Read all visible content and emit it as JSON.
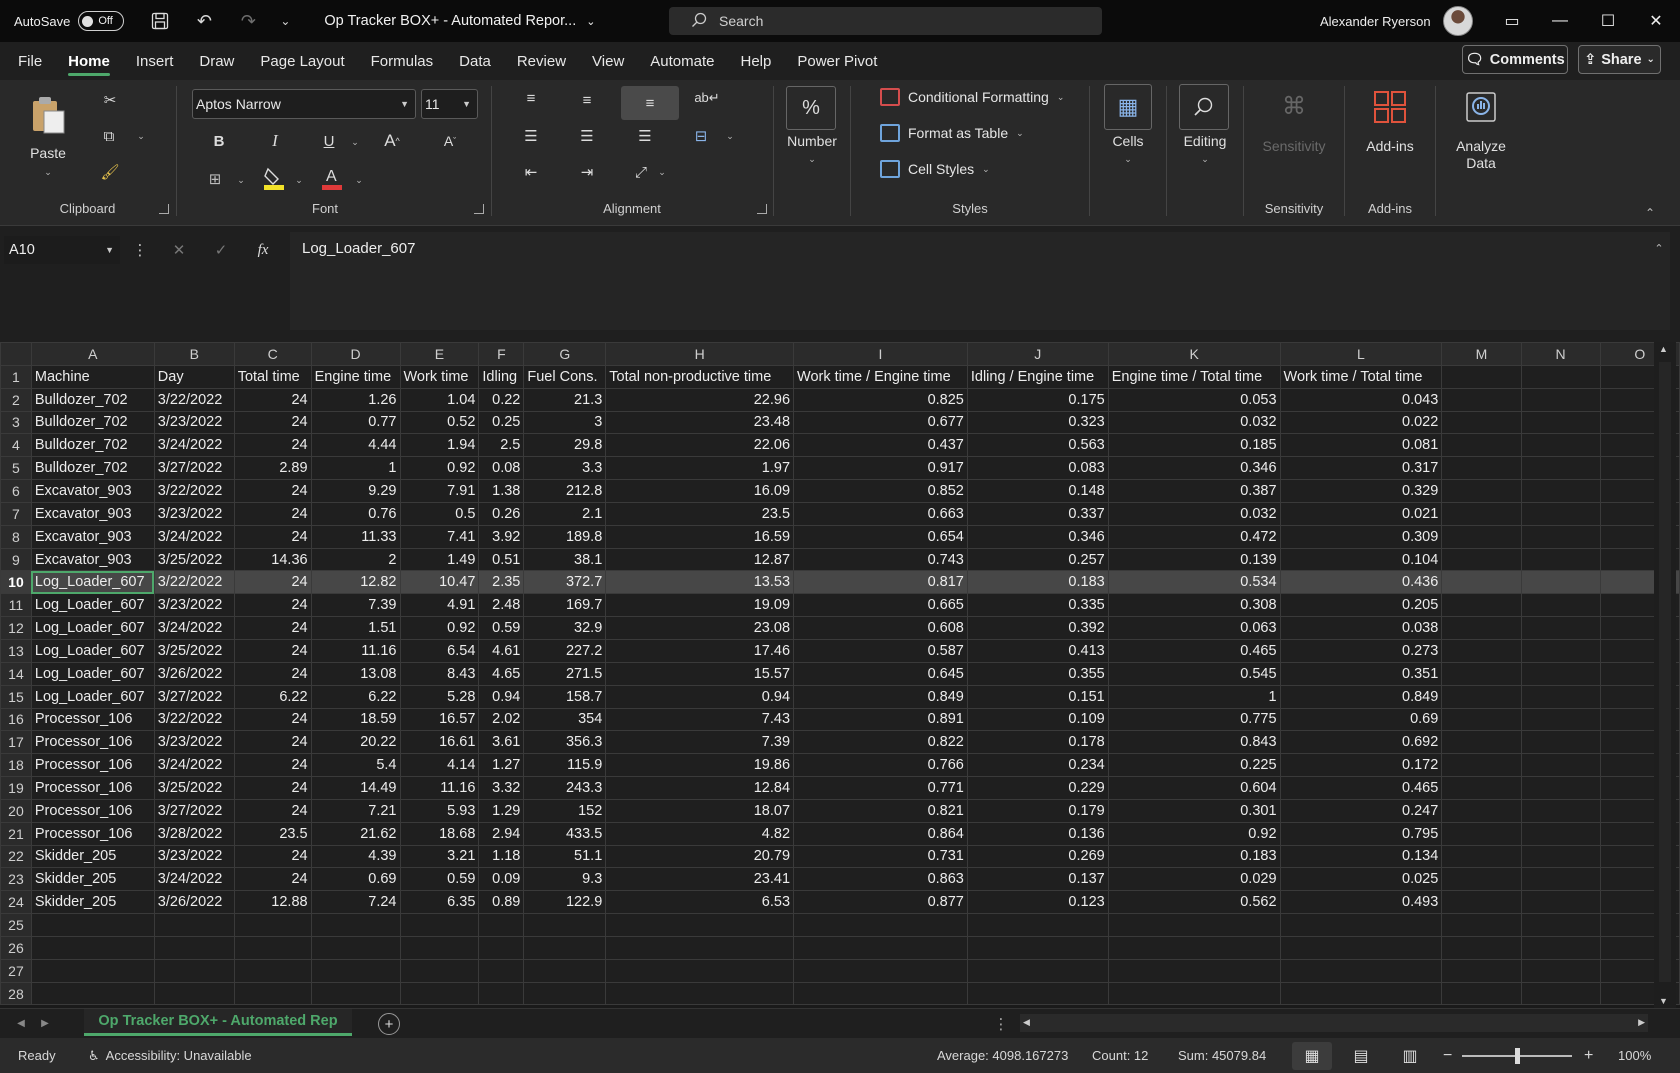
{
  "titlebar": {
    "autosave_label": "AutoSave",
    "autosave_state": "Off",
    "doc_title": "Op Tracker BOX+ - Automated Repor...",
    "search_placeholder": "Search",
    "user_name": "Alexander Ryerson"
  },
  "menu": {
    "tabs": [
      "File",
      "Home",
      "Insert",
      "Draw",
      "Page Layout",
      "Formulas",
      "Data",
      "Review",
      "View",
      "Automate",
      "Help",
      "Power Pivot"
    ],
    "active": "Home",
    "comments_label": "Comments",
    "share_label": "Share"
  },
  "ribbon": {
    "clipboard": {
      "label": "Clipboard",
      "paste": "Paste"
    },
    "font": {
      "label": "Font",
      "name": "Aptos Narrow",
      "size": "11"
    },
    "alignment": {
      "label": "Alignment"
    },
    "number": {
      "label": "Number"
    },
    "styles": {
      "label": "Styles",
      "conditional": "Conditional Formatting",
      "format_table": "Format as Table",
      "cell_styles": "Cell Styles"
    },
    "cells": {
      "label": "Cells"
    },
    "editing": {
      "label": "Editing"
    },
    "sensitivity": {
      "button": "Sensitivity",
      "label": "Sensitivity"
    },
    "addins": {
      "button": "Add-ins",
      "label": "Add-ins"
    },
    "analyze": {
      "line1": "Analyze",
      "line2": "Data"
    }
  },
  "formula_bar": {
    "name_box": "A10",
    "content": "Log_Loader_607"
  },
  "sheet": {
    "columns": [
      "A",
      "B",
      "C",
      "D",
      "E",
      "F",
      "G",
      "H",
      "I",
      "J",
      "K",
      "L",
      "M",
      "N",
      "O"
    ],
    "selected_row": 10,
    "rows": [
      [
        "Machine",
        "Day",
        "Total time",
        "Engine time",
        "Work time",
        "Idling",
        "Fuel Cons.",
        "Total non-productive time",
        "Work time / Engine time",
        "Idling / Engine time",
        "Engine time / Total time",
        "Work time / Total time"
      ],
      [
        "Bulldozer_702",
        "3/22/2022",
        "24",
        "1.26",
        "1.04",
        "0.22",
        "21.3",
        "22.96",
        "0.825",
        "0.175",
        "0.053",
        "0.043"
      ],
      [
        "Bulldozer_702",
        "3/23/2022",
        "24",
        "0.77",
        "0.52",
        "0.25",
        "3",
        "23.48",
        "0.677",
        "0.323",
        "0.032",
        "0.022"
      ],
      [
        "Bulldozer_702",
        "3/24/2022",
        "24",
        "4.44",
        "1.94",
        "2.5",
        "29.8",
        "22.06",
        "0.437",
        "0.563",
        "0.185",
        "0.081"
      ],
      [
        "Bulldozer_702",
        "3/27/2022",
        "2.89",
        "1",
        "0.92",
        "0.08",
        "3.3",
        "1.97",
        "0.917",
        "0.083",
        "0.346",
        "0.317"
      ],
      [
        "Excavator_903",
        "3/22/2022",
        "24",
        "9.29",
        "7.91",
        "1.38",
        "212.8",
        "16.09",
        "0.852",
        "0.148",
        "0.387",
        "0.329"
      ],
      [
        "Excavator_903",
        "3/23/2022",
        "24",
        "0.76",
        "0.5",
        "0.26",
        "2.1",
        "23.5",
        "0.663",
        "0.337",
        "0.032",
        "0.021"
      ],
      [
        "Excavator_903",
        "3/24/2022",
        "24",
        "11.33",
        "7.41",
        "3.92",
        "189.8",
        "16.59",
        "0.654",
        "0.346",
        "0.472",
        "0.309"
      ],
      [
        "Excavator_903",
        "3/25/2022",
        "14.36",
        "2",
        "1.49",
        "0.51",
        "38.1",
        "12.87",
        "0.743",
        "0.257",
        "0.139",
        "0.104"
      ],
      [
        "Log_Loader_607",
        "3/22/2022",
        "24",
        "12.82",
        "10.47",
        "2.35",
        "372.7",
        "13.53",
        "0.817",
        "0.183",
        "0.534",
        "0.436"
      ],
      [
        "Log_Loader_607",
        "3/23/2022",
        "24",
        "7.39",
        "4.91",
        "2.48",
        "169.7",
        "19.09",
        "0.665",
        "0.335",
        "0.308",
        "0.205"
      ],
      [
        "Log_Loader_607",
        "3/24/2022",
        "24",
        "1.51",
        "0.92",
        "0.59",
        "32.9",
        "23.08",
        "0.608",
        "0.392",
        "0.063",
        "0.038"
      ],
      [
        "Log_Loader_607",
        "3/25/2022",
        "24",
        "11.16",
        "6.54",
        "4.61",
        "227.2",
        "17.46",
        "0.587",
        "0.413",
        "0.465",
        "0.273"
      ],
      [
        "Log_Loader_607",
        "3/26/2022",
        "24",
        "13.08",
        "8.43",
        "4.65",
        "271.5",
        "15.57",
        "0.645",
        "0.355",
        "0.545",
        "0.351"
      ],
      [
        "Log_Loader_607",
        "3/27/2022",
        "6.22",
        "6.22",
        "5.28",
        "0.94",
        "158.7",
        "0.94",
        "0.849",
        "0.151",
        "1",
        "0.849"
      ],
      [
        "Processor_106",
        "3/22/2022",
        "24",
        "18.59",
        "16.57",
        "2.02",
        "354",
        "7.43",
        "0.891",
        "0.109",
        "0.775",
        "0.69"
      ],
      [
        "Processor_106",
        "3/23/2022",
        "24",
        "20.22",
        "16.61",
        "3.61",
        "356.3",
        "7.39",
        "0.822",
        "0.178",
        "0.843",
        "0.692"
      ],
      [
        "Processor_106",
        "3/24/2022",
        "24",
        "5.4",
        "4.14",
        "1.27",
        "115.9",
        "19.86",
        "0.766",
        "0.234",
        "0.225",
        "0.172"
      ],
      [
        "Processor_106",
        "3/25/2022",
        "24",
        "14.49",
        "11.16",
        "3.32",
        "243.3",
        "12.84",
        "0.771",
        "0.229",
        "0.604",
        "0.465"
      ],
      [
        "Processor_106",
        "3/27/2022",
        "24",
        "7.21",
        "5.93",
        "1.29",
        "152",
        "18.07",
        "0.821",
        "0.179",
        "0.301",
        "0.247"
      ],
      [
        "Processor_106",
        "3/28/2022",
        "23.5",
        "21.62",
        "18.68",
        "2.94",
        "433.5",
        "4.82",
        "0.864",
        "0.136",
        "0.92",
        "0.795"
      ],
      [
        "Skidder_205",
        "3/23/2022",
        "24",
        "4.39",
        "3.21",
        "1.18",
        "51.1",
        "20.79",
        "0.731",
        "0.269",
        "0.183",
        "0.134"
      ],
      [
        "Skidder_205",
        "3/24/2022",
        "24",
        "0.69",
        "0.59",
        "0.09",
        "9.3",
        "23.41",
        "0.863",
        "0.137",
        "0.029",
        "0.025"
      ],
      [
        "Skidder_205",
        "3/26/2022",
        "12.88",
        "7.24",
        "6.35",
        "0.89",
        "122.9",
        "6.53",
        "0.877",
        "0.123",
        "0.562",
        "0.493"
      ],
      [],
      [],
      [],
      []
    ]
  },
  "tabs": {
    "sheet_name": "Op Tracker BOX+ - Automated Rep"
  },
  "status": {
    "ready": "Ready",
    "accessibility": "Accessibility: Unavailable",
    "average": "Average: 4098.167273",
    "count": "Count: 12",
    "sum": "Sum: 45079.84",
    "zoom": "100%"
  }
}
